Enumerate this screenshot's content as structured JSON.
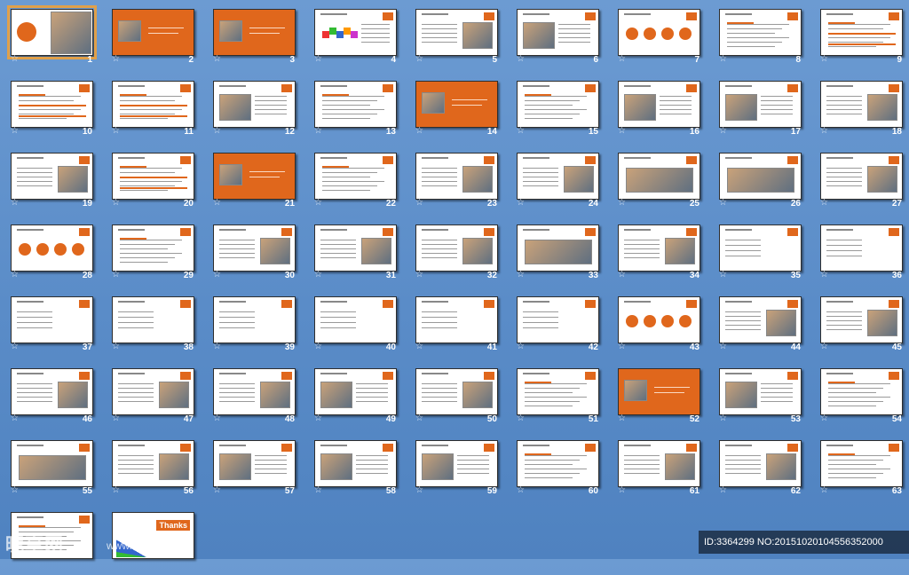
{
  "slides": [
    {
      "number": "1",
      "kind": "cover",
      "selected": true
    },
    {
      "number": "2",
      "kind": "orange"
    },
    {
      "number": "3",
      "kind": "orange"
    },
    {
      "number": "4",
      "kind": "blocks"
    },
    {
      "number": "5",
      "kind": "photo-right"
    },
    {
      "number": "6",
      "kind": "photo-left"
    },
    {
      "number": "7",
      "kind": "circles"
    },
    {
      "number": "8",
      "kind": "text"
    },
    {
      "number": "9",
      "kind": "table"
    },
    {
      "number": "10",
      "kind": "table"
    },
    {
      "number": "11",
      "kind": "table"
    },
    {
      "number": "12",
      "kind": "photo-left"
    },
    {
      "number": "13",
      "kind": "text"
    },
    {
      "number": "14",
      "kind": "orange"
    },
    {
      "number": "15",
      "kind": "text"
    },
    {
      "number": "16",
      "kind": "photo-left"
    },
    {
      "number": "17",
      "kind": "photo-left"
    },
    {
      "number": "18",
      "kind": "photo-right"
    },
    {
      "number": "19",
      "kind": "photo-right"
    },
    {
      "number": "20",
      "kind": "table"
    },
    {
      "number": "21",
      "kind": "orange"
    },
    {
      "number": "22",
      "kind": "text"
    },
    {
      "number": "23",
      "kind": "photo-right"
    },
    {
      "number": "24",
      "kind": "photo-right"
    },
    {
      "number": "25",
      "kind": "photo-wide"
    },
    {
      "number": "26",
      "kind": "photo-wide"
    },
    {
      "number": "27",
      "kind": "photo-right"
    },
    {
      "number": "28",
      "kind": "circles"
    },
    {
      "number": "29",
      "kind": "text"
    },
    {
      "number": "30",
      "kind": "photo-right"
    },
    {
      "number": "31",
      "kind": "photo-right"
    },
    {
      "number": "32",
      "kind": "photo-right"
    },
    {
      "number": "33",
      "kind": "photo-wide"
    },
    {
      "number": "34",
      "kind": "photo-right"
    },
    {
      "number": "35",
      "kind": "fan"
    },
    {
      "number": "36",
      "kind": "fan"
    },
    {
      "number": "37",
      "kind": "fan"
    },
    {
      "number": "38",
      "kind": "fan"
    },
    {
      "number": "39",
      "kind": "fan"
    },
    {
      "number": "40",
      "kind": "fan"
    },
    {
      "number": "41",
      "kind": "fan"
    },
    {
      "number": "42",
      "kind": "fan"
    },
    {
      "number": "43",
      "kind": "circles"
    },
    {
      "number": "44",
      "kind": "photo-right"
    },
    {
      "number": "45",
      "kind": "photo-right"
    },
    {
      "number": "46",
      "kind": "photo-right"
    },
    {
      "number": "47",
      "kind": "photo-right"
    },
    {
      "number": "48",
      "kind": "photo-right"
    },
    {
      "number": "49",
      "kind": "photo-left"
    },
    {
      "number": "50",
      "kind": "photo-right"
    },
    {
      "number": "51",
      "kind": "text"
    },
    {
      "number": "52",
      "kind": "orange"
    },
    {
      "number": "53",
      "kind": "photo-left"
    },
    {
      "number": "54",
      "kind": "text"
    },
    {
      "number": "55",
      "kind": "photo-wide"
    },
    {
      "number": "56",
      "kind": "photo-right"
    },
    {
      "number": "57",
      "kind": "photo-left"
    },
    {
      "number": "58",
      "kind": "photo-left"
    },
    {
      "number": "59",
      "kind": "photo-left"
    },
    {
      "number": "60",
      "kind": "text"
    },
    {
      "number": "61",
      "kind": "photo-right"
    },
    {
      "number": "62",
      "kind": "photo-right"
    },
    {
      "number": "63",
      "kind": "text"
    },
    {
      "number": "",
      "kind": "text"
    },
    {
      "number": "",
      "kind": "thanks"
    }
  ],
  "thanks_label": "Thanks",
  "watermark": {
    "logo": "昵享网",
    "url": "www.nipic.cn"
  },
  "id_caption": "ID:3364299 NO:20151020104556352000",
  "colors": {
    "accent": "#e0671c",
    "background": "#5a8cc8",
    "selection": "#e0a04a"
  }
}
